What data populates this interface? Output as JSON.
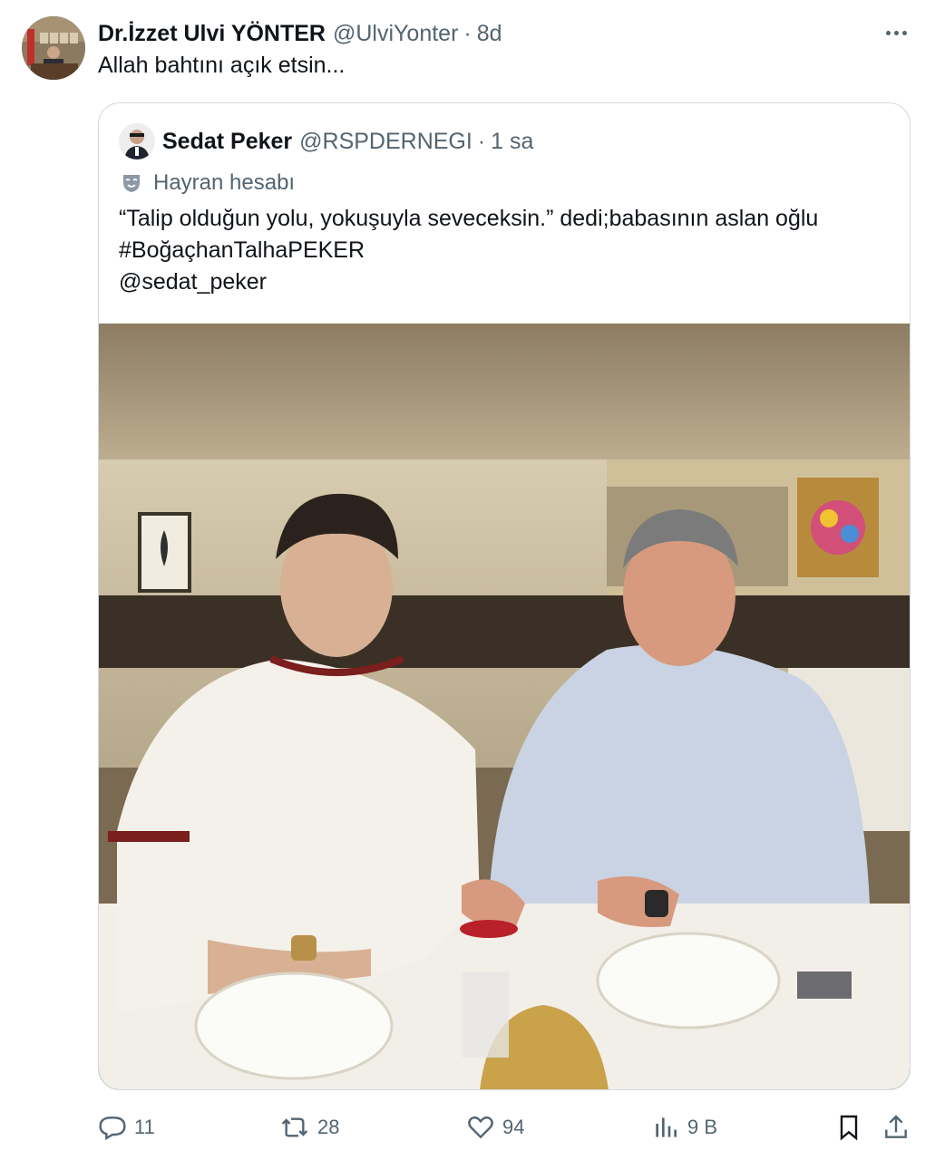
{
  "tweet": {
    "author_name": "Dr.İzzet Ulvi YÖNTER",
    "author_handle": "@UlviYonter",
    "dot": "·",
    "time": "8d",
    "text": "Allah bahtını açık etsin..."
  },
  "quoted": {
    "author_name": "Sedat Peker",
    "author_handle": "@RSPDERNEGI",
    "dot": "·",
    "time": "1 sa",
    "label": "Hayran hesabı",
    "lines": [
      "“Talip olduğun yolu, yokuşuyla seveceksin.” dedi;babasının aslan oğlu",
      "#BoğaçhanTalhaPEKER",
      "@sedat_peker"
    ]
  },
  "actions": {
    "replies": "11",
    "reposts": "28",
    "likes": "94",
    "views": "9 B"
  },
  "icons": {
    "more": "more-icon",
    "fan": "mask-icon",
    "reply": "reply-icon",
    "repost": "repost-icon",
    "like": "heart-icon",
    "views": "views-icon",
    "bookmark": "bookmark-icon",
    "share": "share-icon"
  }
}
